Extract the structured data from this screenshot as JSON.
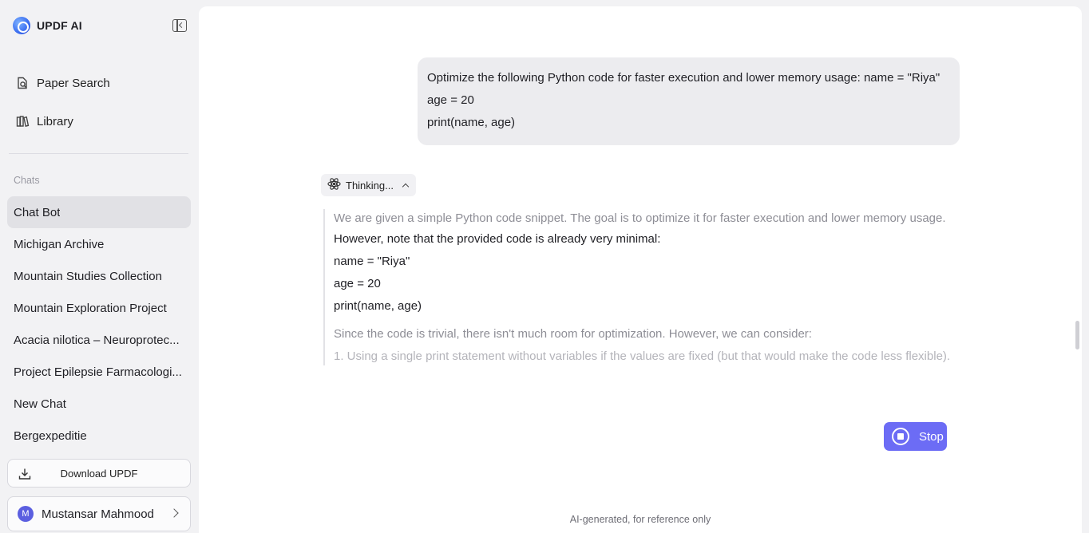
{
  "app": {
    "name": "UPDF AI",
    "accent_color": "#6c6cf5"
  },
  "sidebar": {
    "nav": [
      {
        "label": "Paper Search",
        "icon": "paper-search-icon"
      },
      {
        "label": "Library",
        "icon": "library-icon"
      }
    ],
    "chats_heading": "Chats",
    "chats": [
      {
        "label": "Chat Bot",
        "active": true
      },
      {
        "label": "Michigan Archive",
        "active": false
      },
      {
        "label": "Mountain Studies Collection",
        "active": false
      },
      {
        "label": "Mountain Exploration Project",
        "active": false
      },
      {
        "label": "Acacia nilotica – Neuroprotec...",
        "active": false
      },
      {
        "label": "Project Epilepsie Farmacologi...",
        "active": false
      },
      {
        "label": "New Chat",
        "active": false
      },
      {
        "label": "Bergexpeditie",
        "active": false
      }
    ],
    "download_label": "Download UPDF",
    "user": {
      "initial": "M",
      "name": "Mustansar Mahmood"
    }
  },
  "conversation": {
    "user_message_lines": [
      "Optimize the following Python code for faster execution and lower memory usage: name = \"Riya\"",
      "age = 20",
      "print(name, age)"
    ],
    "thinking_label": "Thinking...",
    "thinking_lines": [
      "We are given a simple Python code snippet. The goal is to optimize it for faster execution and lower memory usage.",
      "However, note that the provided code is already very minimal:",
      "name = \"Riya\"",
      "age = 20",
      "print(name, age)",
      "Since the code is trivial, there isn't much room for optimization. However, we can consider:",
      "1. Using a single print statement without variables if the values are fixed (but that would make the code less flexible)."
    ],
    "stop_label": "Stop",
    "disclaimer": "AI-generated, for reference only"
  }
}
